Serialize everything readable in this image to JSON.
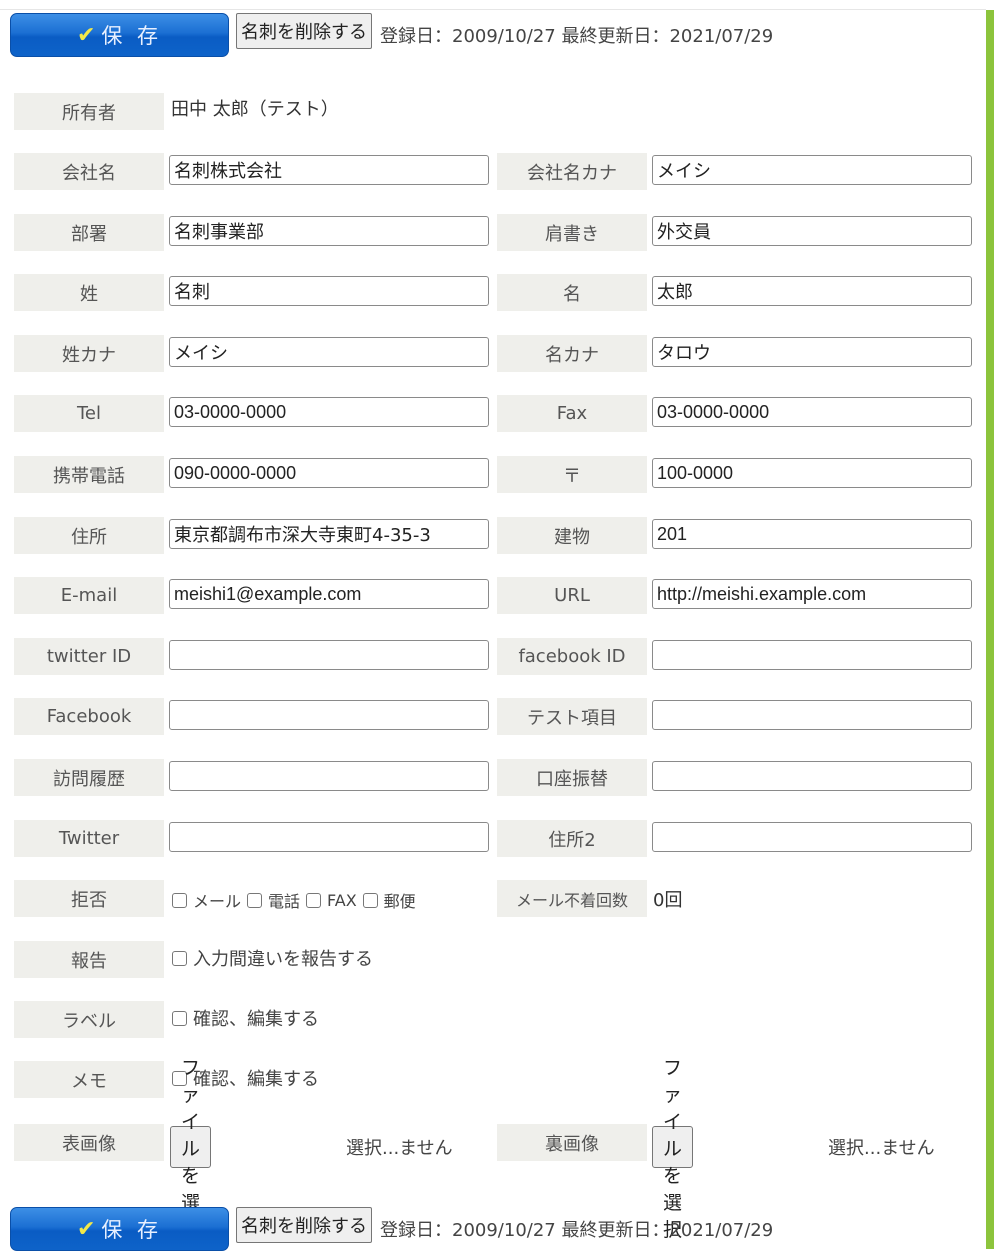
{
  "actions": {
    "save_label": "保 存",
    "save_icon": "check-icon",
    "delete_label": "名刺を削除する",
    "dates": "登録日：2009/10/27 最終更新日：2021/07/29"
  },
  "colors": {
    "save_button": "#1b6fd3",
    "accent_bar": "#8cc43c",
    "label_bg": "#efefeb"
  },
  "owner": {
    "label": "所有者",
    "value": "田中 太郎（テスト）"
  },
  "fields": [
    {
      "left": {
        "label": "会社名",
        "value": "名刺株式会社"
      },
      "right": {
        "label": "会社名カナ",
        "value": "メイシ"
      }
    },
    {
      "left": {
        "label": "部署",
        "value": "名刺事業部"
      },
      "right": {
        "label": "肩書き",
        "value": "外交員"
      }
    },
    {
      "left": {
        "label": "姓",
        "value": "名刺"
      },
      "right": {
        "label": "名",
        "value": "太郎"
      }
    },
    {
      "left": {
        "label": "姓カナ",
        "value": "メイシ"
      },
      "right": {
        "label": "名カナ",
        "value": "タロウ"
      }
    },
    {
      "left": {
        "label": "Tel",
        "value": "03-0000-0000"
      },
      "right": {
        "label": "Fax",
        "value": "03-0000-0000"
      }
    },
    {
      "left": {
        "label": "携帯電話",
        "value": "090-0000-0000"
      },
      "right": {
        "label": "〒",
        "value": "100-0000"
      }
    },
    {
      "left": {
        "label": "住所",
        "value": "東京都調布市深大寺東町4-35-3"
      },
      "right": {
        "label": "建物",
        "value": "201"
      }
    },
    {
      "left": {
        "label": "E-mail",
        "value": "meishi1@example.com"
      },
      "right": {
        "label": "URL",
        "value": "http://meishi.example.com"
      }
    },
    {
      "left": {
        "label": "twitter ID",
        "value": ""
      },
      "right": {
        "label": "facebook ID",
        "value": ""
      }
    },
    {
      "left": {
        "label": "Facebook",
        "value": ""
      },
      "right": {
        "label": "テスト項目",
        "value": ""
      }
    },
    {
      "left": {
        "label": "訪問履歴",
        "value": ""
      },
      "right": {
        "label": "口座振替",
        "value": ""
      }
    },
    {
      "left": {
        "label": "Twitter",
        "value": ""
      },
      "right": {
        "label": "住所2",
        "value": ""
      }
    }
  ],
  "refusal": {
    "label": "拒否",
    "options": [
      {
        "label": "メール",
        "checked": false
      },
      {
        "label": "電話",
        "checked": false
      },
      {
        "label": "FAX",
        "checked": false
      },
      {
        "label": "郵便",
        "checked": false
      }
    ],
    "bounce_label": "メール不着回数",
    "bounce_value": "0回"
  },
  "report": {
    "label": "報告",
    "option": "入力間違いを報告する",
    "checked": false
  },
  "label_row": {
    "label": "ラベル",
    "option": "確認、編集する",
    "checked": false
  },
  "memo": {
    "label": "メモ",
    "option": "確認、編集する",
    "checked": false
  },
  "images": {
    "front": {
      "label": "表画像",
      "button": "ファイルを選択",
      "status": "選択...ません"
    },
    "back": {
      "label": "裏画像",
      "button": "ファイルを選択",
      "status": "選択...ません"
    }
  }
}
